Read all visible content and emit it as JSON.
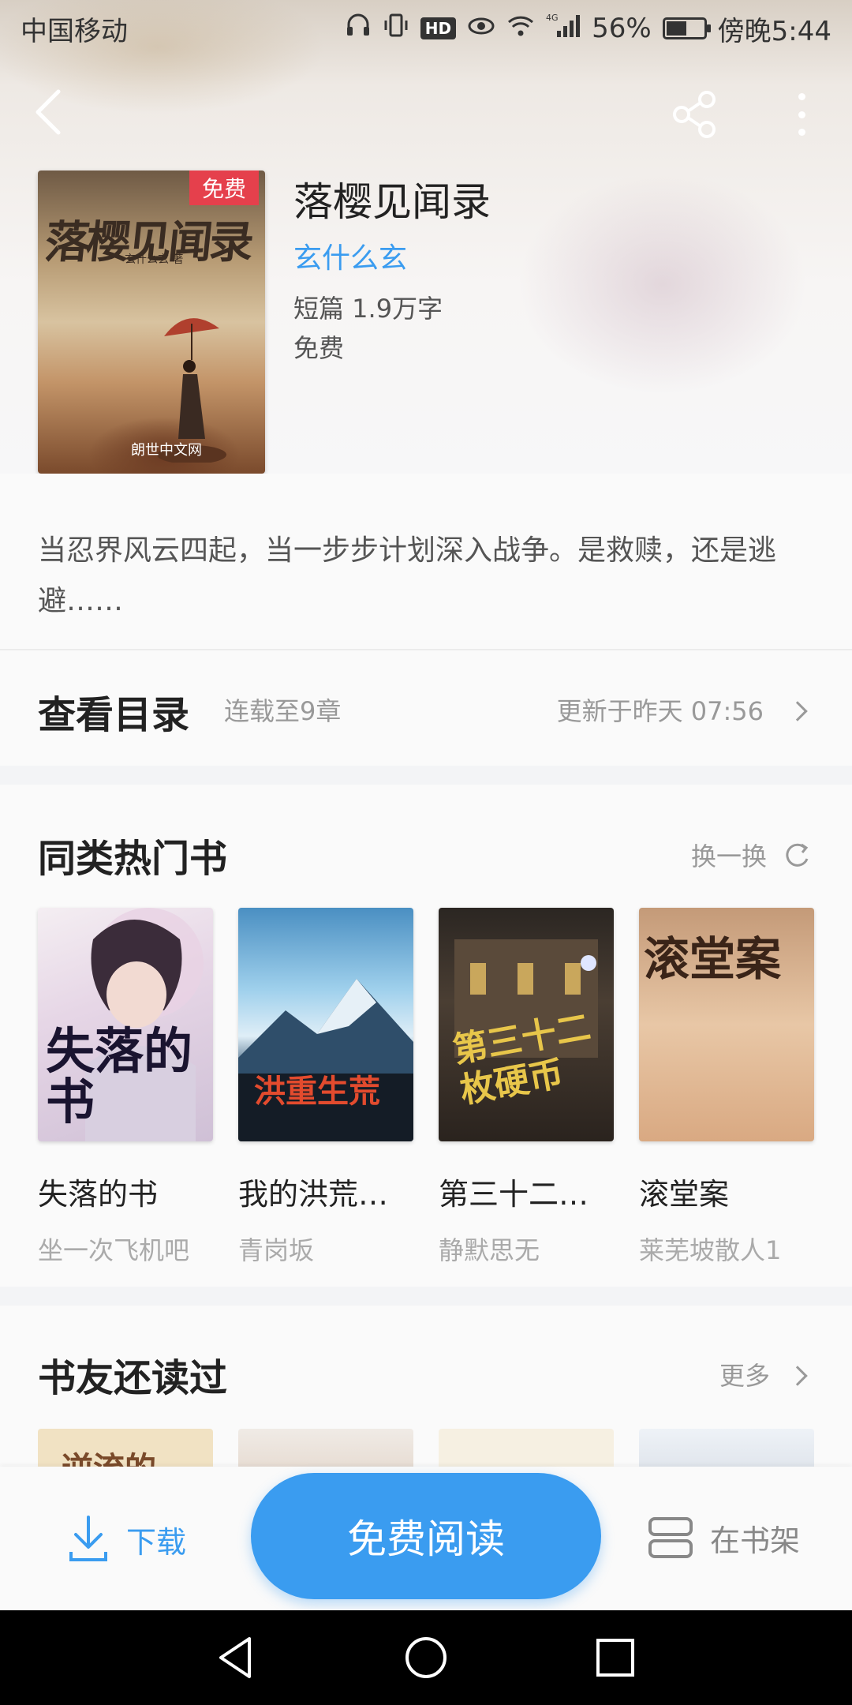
{
  "status_bar": {
    "carrier": "中国移动",
    "network": "4G",
    "battery": "56%",
    "battery_level": 0.56,
    "time": "傍晚5:44",
    "hd_label": "HD"
  },
  "book": {
    "title": "落樱见闻录",
    "author": "玄什么玄",
    "meta": "短篇   1.9万字",
    "price": "免费",
    "badge": "免费",
    "cover_title": "落樱见闻录",
    "cover_author": "玄什么玄 著",
    "cover_publisher": "朗世中文网",
    "description": "当忍界风云四起，当一步步计划深入战争。是救赎，还是逃避……"
  },
  "catalog": {
    "title": "查看目录",
    "status": "连载至9章",
    "updated": "更新于昨天 07:56"
  },
  "similar": {
    "title": "同类热门书",
    "action": "换一换",
    "books": [
      {
        "name": "失落的书",
        "author": "坐一次飞机吧",
        "cover_text": "失落的书"
      },
      {
        "name": "我的洪荒…",
        "author": "青岗坂",
        "cover_text": "洪重生荒"
      },
      {
        "name": "第三十二…",
        "author": "静默思无",
        "cover_text": "第三十二枚硬币"
      },
      {
        "name": "滚堂案",
        "author": "莱芜坡散人1",
        "cover_text": "滚堂案"
      }
    ]
  },
  "also_read": {
    "title": "书友还读过",
    "action": "更多",
    "peek_cover_text": "逆流的"
  },
  "bottom_bar": {
    "download": "下载",
    "read": "免费阅读",
    "shelf": "在书架"
  },
  "colors": {
    "accent": "#3a9cf0",
    "badge": "#e5404c"
  }
}
